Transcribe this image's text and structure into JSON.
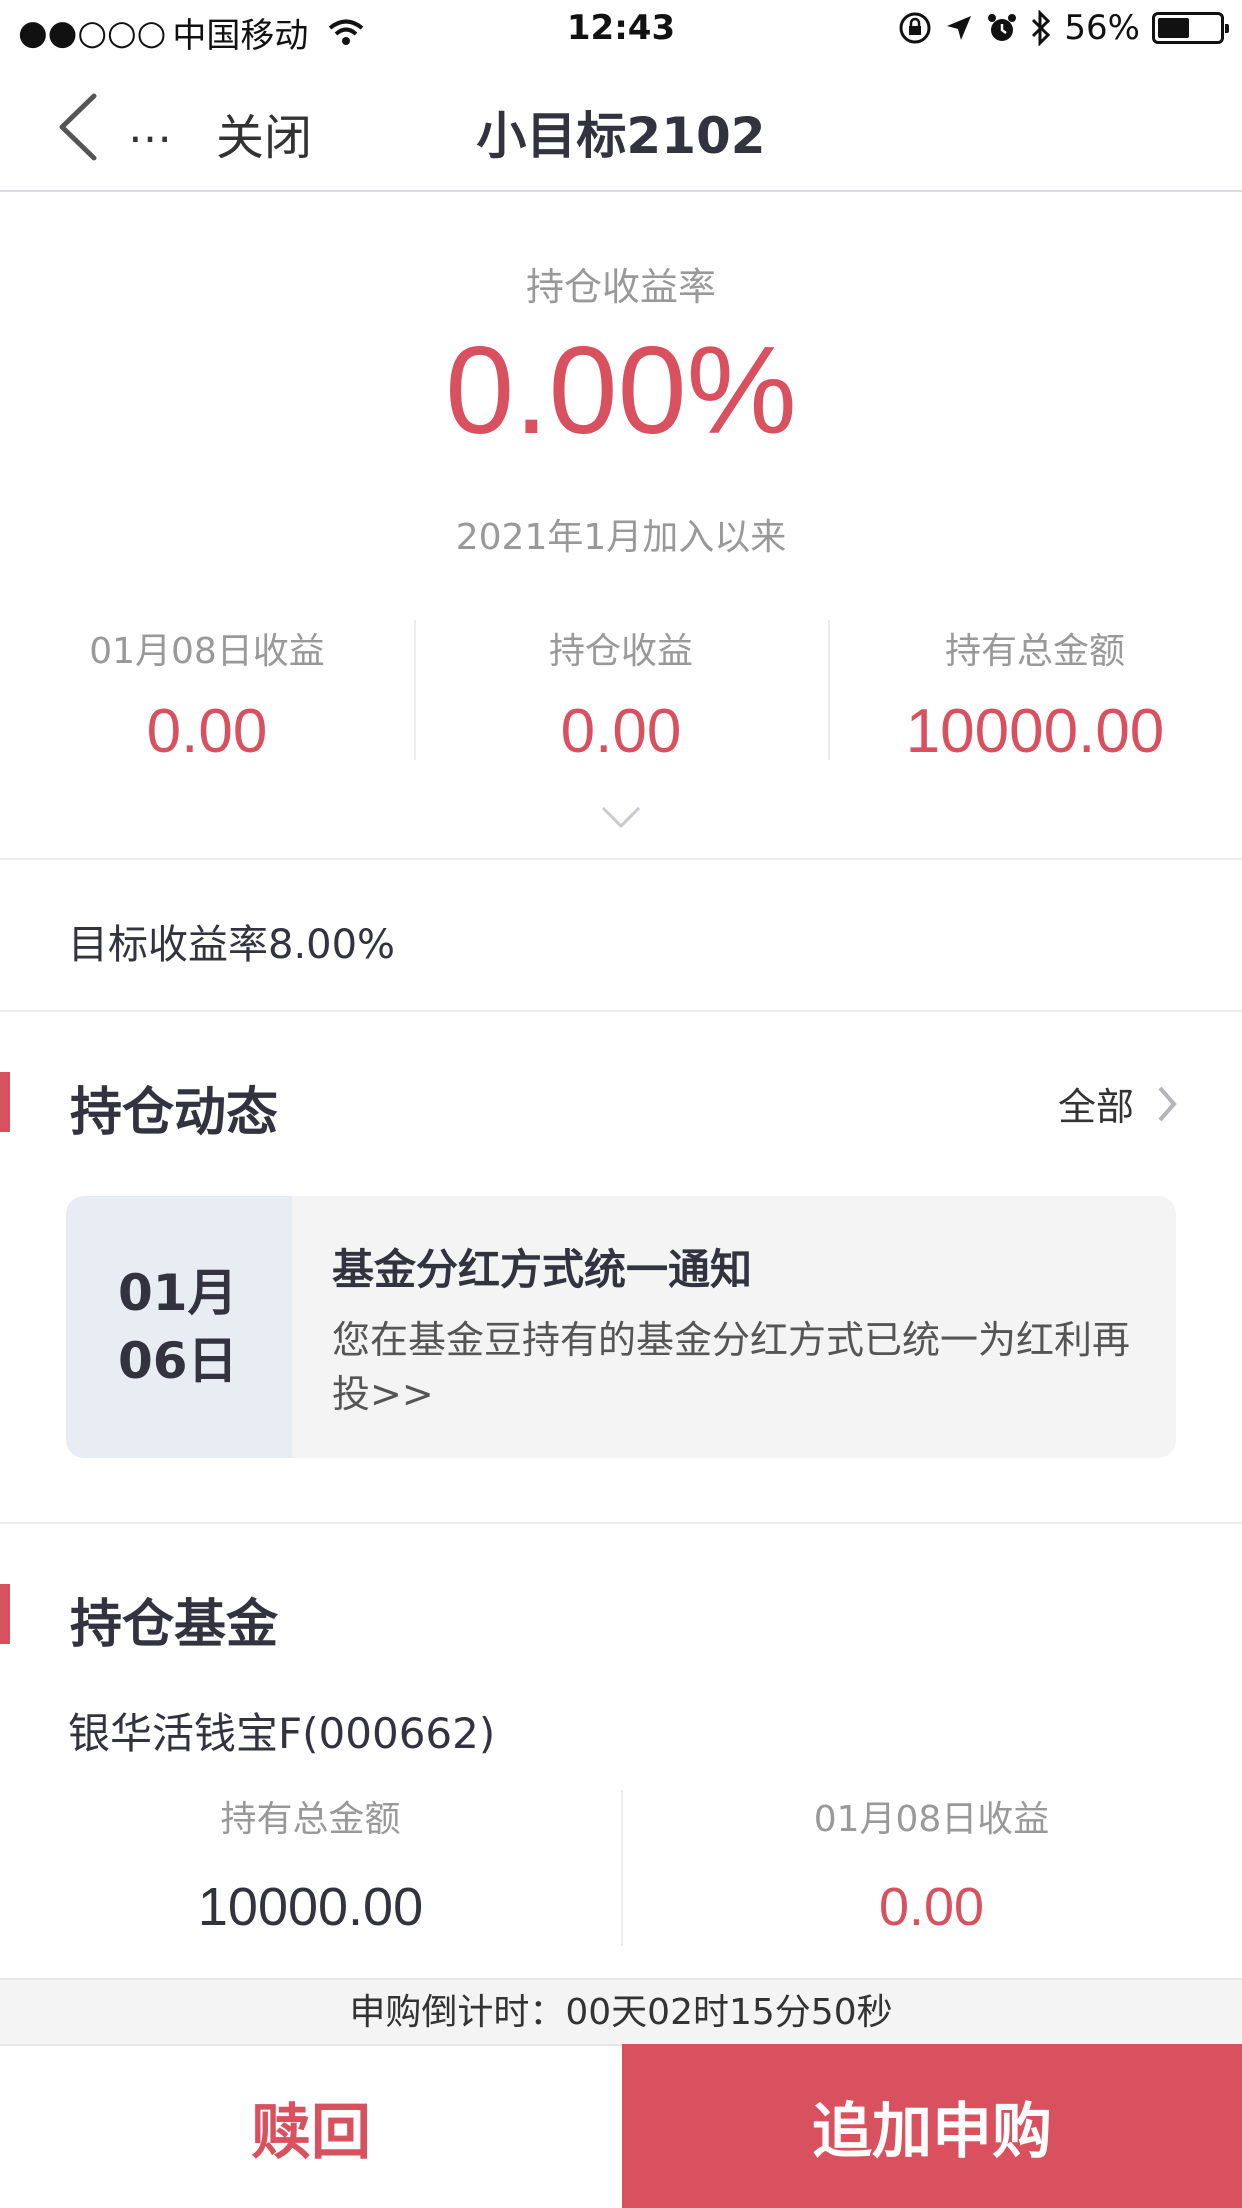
{
  "status_bar": {
    "signal": "●●○○○",
    "carrier": "中国移动",
    "time": "12:43",
    "battery": "56%",
    "battery_level": 0.56
  },
  "nav": {
    "more": "…",
    "close": "关闭",
    "title": "小目标2102"
  },
  "hero": {
    "label": "持仓收益率",
    "rate": "0.00%",
    "since": "2021年1月加入以来"
  },
  "stats": [
    {
      "label": "01月08日收益",
      "value": "0.00"
    },
    {
      "label": "持仓收益",
      "value": "0.00"
    },
    {
      "label": "持有总金额",
      "value": "10000.00"
    }
  ],
  "target_rate": "目标收益率8.00%",
  "dynamics": {
    "title": "持仓动态",
    "more": "全部",
    "card": {
      "month": "01月",
      "day": "06日",
      "title": "基金分红方式统一通知",
      "text": "您在基金豆持有的基金分红方式已统一为红利再投>>"
    }
  },
  "holdings": {
    "title": "持仓基金",
    "fund_name": "银华活钱宝F(000662)",
    "stats": [
      {
        "label": "持有总金额",
        "value": "10000.00"
      },
      {
        "label": "01月08日收益",
        "value": "0.00"
      }
    ]
  },
  "countdown": "申购倒计时：00天02时15分50秒",
  "actions": {
    "redeem": "赎回",
    "buy": "追加申购"
  },
  "colors": {
    "accent": "#d9505f",
    "text": "#333340",
    "muted": "#999999"
  }
}
